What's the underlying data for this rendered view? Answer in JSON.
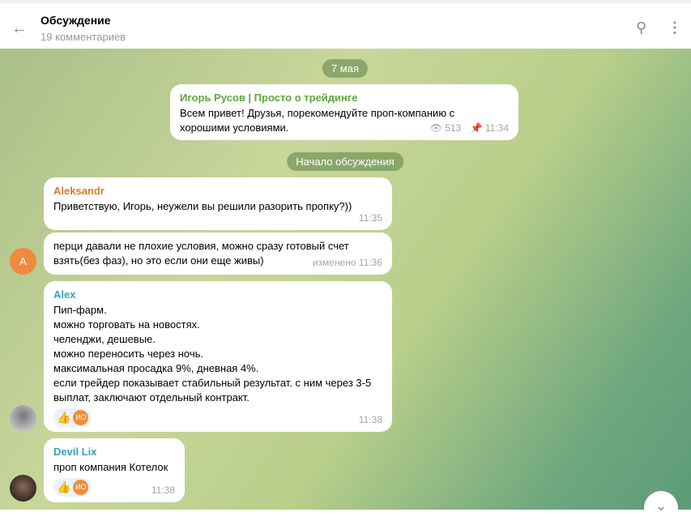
{
  "header": {
    "title": "Обсуждение",
    "subtitle": "19 комментариев"
  },
  "date": "7 мая",
  "post": {
    "author": "Игорь Русов | Просто о трейдинге",
    "text": "Всем привет! Друзья, порекомендуйте проп-компанию с хорошими условиями.",
    "views": "513",
    "time": "11:34"
  },
  "discussion_start": "Начало обсуждения",
  "messages": [
    {
      "author": "Aleksandr",
      "text": "Приветствую, Игорь, неужели вы решили разорить пропку?))",
      "time": "11:35"
    },
    {
      "text": "перци давали не плохие условия, можно сразу готовый счет взять(без фаз), но это если они еще живы)",
      "time": "изменено 11:36",
      "avatar": "A"
    },
    {
      "author": "Alex",
      "lines": [
        "Пип-фарм.",
        "можно торговать на новостях.",
        "челенджи, дешевые.",
        "можно переносить через ночь.",
        "максимальная просадка 9%, дневная 4%.",
        "если трейдер показывает стабильный результат. с ним через 3-5 выплат, заключают отдельный контракт."
      ],
      "reactions": [
        "👍",
        "ИО"
      ],
      "time": "11:38"
    },
    {
      "author": "Devil Lix",
      "text": "проп компания Котелок",
      "reactions": [
        "👍",
        "ИО"
      ],
      "time": "11:38"
    }
  ]
}
